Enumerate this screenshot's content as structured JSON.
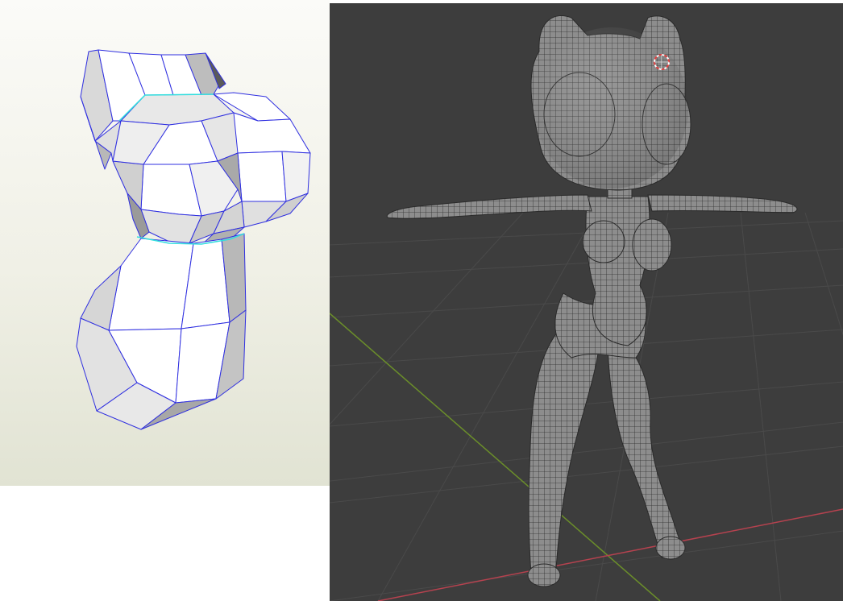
{
  "left_view": {
    "background_top": "#fbfbf8",
    "background_bottom": "#e1e3d3",
    "edge_color": "#2f2fe0",
    "seam_color": "#33dede",
    "face_light": "#ffffff",
    "face_shade": "#cfcfcf",
    "face_dark": "#9c9c9c"
  },
  "viewport": {
    "background": "#3d3d3d",
    "grid_color": "#4a4a4a",
    "x_axis_color": "#b6424f",
    "y_axis_color": "#6b8e2a",
    "mesh_fill": "#8b8b8b",
    "wire_color": "#2a2a2a",
    "cursor_color": "#e04040",
    "cursor_inner": "#ffffff"
  }
}
